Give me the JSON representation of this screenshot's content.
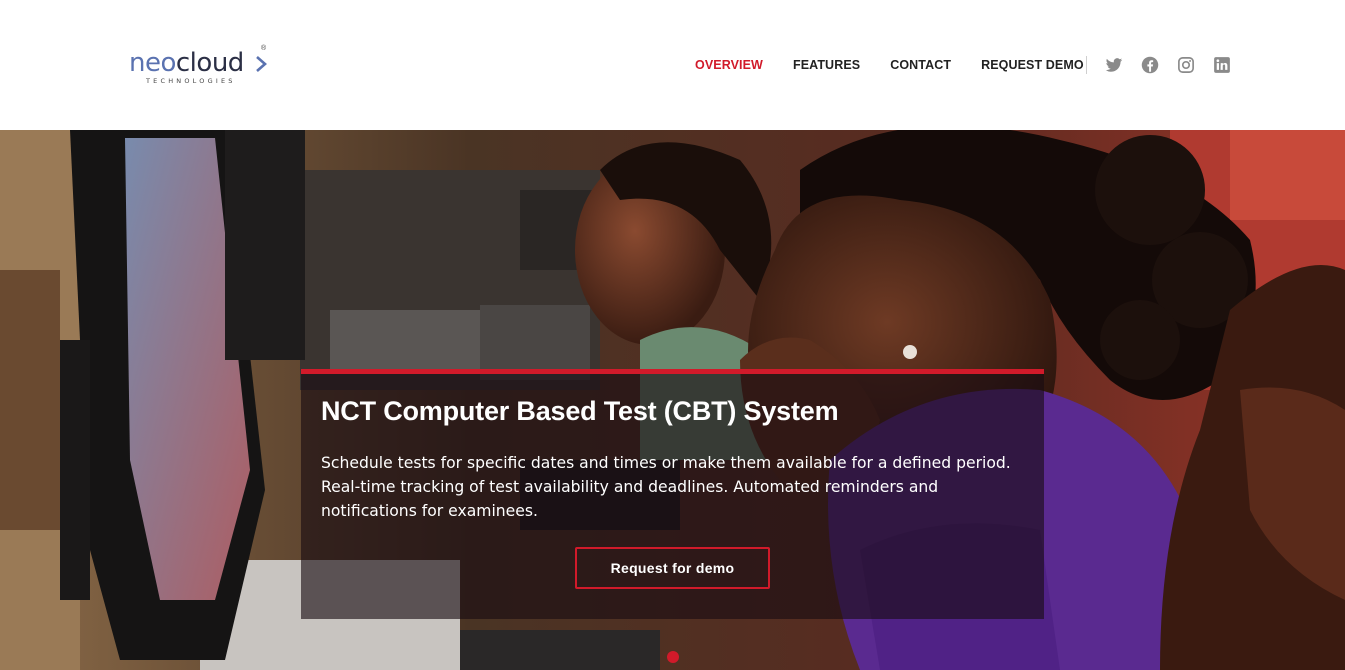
{
  "logo": {
    "primary_a": "neo",
    "primary_b": "cloud",
    "subtitle": "TECHNOLOGIES",
    "registered": "®"
  },
  "nav": {
    "items": [
      {
        "label": "OVERVIEW",
        "active": true
      },
      {
        "label": "FEATURES",
        "active": false
      },
      {
        "label": "CONTACT",
        "active": false
      },
      {
        "label": "REQUEST DEMO",
        "active": false
      }
    ]
  },
  "social": {
    "icons": [
      "twitter-icon",
      "facebook-icon",
      "instagram-icon",
      "linkedin-icon"
    ]
  },
  "hero": {
    "title": "NCT Computer Based Test (CBT) System",
    "description": "Schedule tests for specific dates and times or make them available for a defined period. Real-time tracking of test availability and deadlines. Automated reminders and notifications for examinees.",
    "button_label": "Request for demo"
  },
  "colors": {
    "accent": "#d11a2a",
    "logo_blue": "#5a72b0",
    "logo_dark": "#2b2f45",
    "nav_text": "#222222",
    "social_icon": "#8a8a8a"
  }
}
